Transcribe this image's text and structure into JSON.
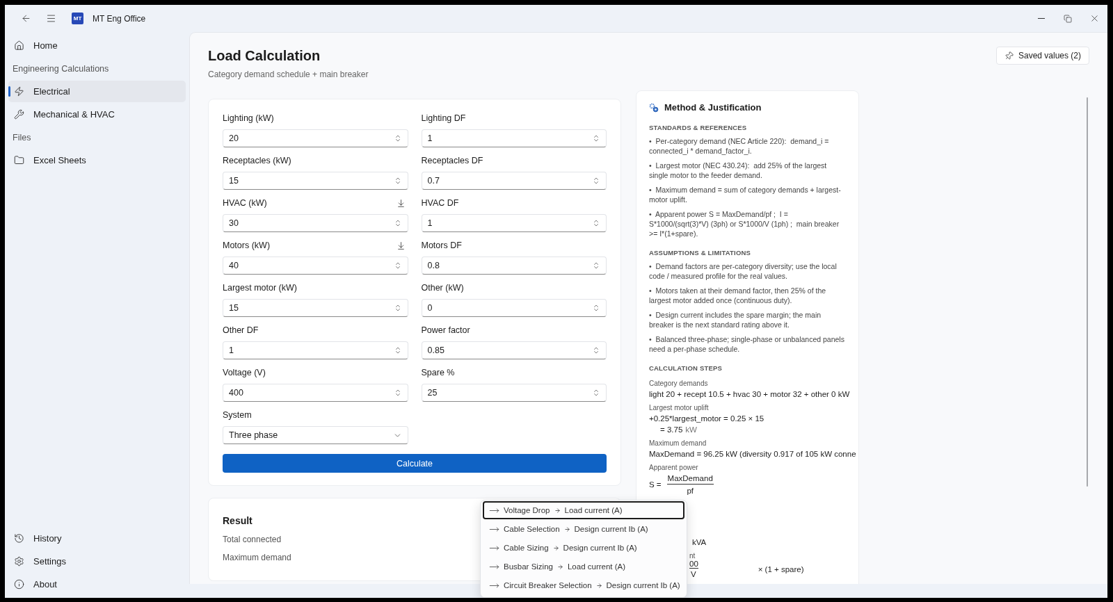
{
  "window": {
    "title": "MT Eng Office",
    "logo": "MT"
  },
  "sidebar": {
    "items": [
      {
        "kind": "item",
        "label": "Home",
        "selected": false
      },
      {
        "kind": "header",
        "label": "Engineering Calculations"
      },
      {
        "kind": "item",
        "label": "Electrical",
        "selected": true
      },
      {
        "kind": "item",
        "label": "Mechanical & HVAC",
        "selected": false
      },
      {
        "kind": "header",
        "label": "Files"
      },
      {
        "kind": "item",
        "label": "Excel Sheets",
        "selected": false
      }
    ],
    "footer": [
      {
        "label": "History"
      },
      {
        "label": "Settings"
      },
      {
        "label": "About"
      }
    ]
  },
  "page": {
    "title": "Load Calculation",
    "subtitle": "Category demand schedule + main breaker",
    "saved_button": "Saved values (2)"
  },
  "form": {
    "fields": [
      {
        "kind": "number",
        "label": "Lighting (kW)",
        "value": "20",
        "download": false
      },
      {
        "kind": "number",
        "label": "Lighting DF",
        "value": "1",
        "download": false
      },
      {
        "kind": "number",
        "label": "Receptacles (kW)",
        "value": "15",
        "download": false
      },
      {
        "kind": "number",
        "label": "Receptacles DF",
        "value": "0.7",
        "download": false
      },
      {
        "kind": "number",
        "label": "HVAC (kW)",
        "value": "30",
        "download": true
      },
      {
        "kind": "number",
        "label": "HVAC DF",
        "value": "1",
        "download": false
      },
      {
        "kind": "number",
        "label": "Motors (kW)",
        "value": "40",
        "download": true
      },
      {
        "kind": "number",
        "label": "Motors DF",
        "value": "0.8",
        "download": false
      },
      {
        "kind": "number",
        "label": "Largest motor (kW)",
        "value": "15",
        "download": false
      },
      {
        "kind": "number",
        "label": "Other (kW)",
        "value": "0",
        "download": false
      },
      {
        "kind": "number",
        "label": "Other DF",
        "value": "1",
        "download": false
      },
      {
        "kind": "number",
        "label": "Power factor",
        "value": "0.85",
        "download": false
      },
      {
        "kind": "number",
        "label": "Voltage (V)",
        "value": "400",
        "download": false
      },
      {
        "kind": "number",
        "label": "Spare %",
        "value": "25",
        "download": false
      },
      {
        "kind": "select",
        "label": "System",
        "value": "Three phase",
        "download": false
      }
    ],
    "button": "Calculate"
  },
  "result": {
    "title": "Result",
    "rows": [
      "Total connected",
      "Maximum demand"
    ]
  },
  "method": {
    "title": "Method & Justification",
    "sections": [
      {
        "heading": "STANDARDS & REFERENCES",
        "bullets": [
          "•  Per-category demand (NEC Article 220):  demand_i = connected_i * demand_factor_i.",
          "•  Largest motor (NEC 430.24):  add 25% of the largest single motor to the feeder demand.",
          "•  Maximum demand = sum of category demands + largest-motor uplift.",
          "•  Apparent power S = MaxDemand/pf ;  I = S*1000/(sqrt(3)*V) (3ph) or S*1000/V (1ph) ;  main breaker >= I*(1+spare)."
        ]
      },
      {
        "heading": "ASSUMPTIONS & LIMITATIONS",
        "bullets": [
          "•  Demand factors are per-category diversity; use the local code / measured profile for the real values.",
          "•  Motors taken at their demand factor, then 25% of the largest motor added once (continuous duty).",
          "•  Design current includes the spare margin; the main breaker is the next standard rating above it.",
          "•  Balanced three-phase; single-phase or unbalanced panels need a per-phase schedule."
        ]
      }
    ],
    "steps_heading": "CALCULATION STEPS",
    "steps": [
      {
        "kind": "line",
        "label": "Category demands",
        "lines": [
          "light 20 + recept 10.5 + hvac 30 + motor 32 + other 0 kW"
        ]
      },
      {
        "kind": "line",
        "label": "Largest motor uplift",
        "lines": [
          "+0.25*largest_motor = 0.25 × 15"
        ],
        "result": "= 3.75",
        "unit": "kW"
      },
      {
        "kind": "line",
        "label": "Maximum demand",
        "lines": [
          "MaxDemand = 96.25 kW (diversity 0.917 of 105 kW conne"
        ]
      },
      {
        "kind": "fraction",
        "label": "Apparent power",
        "lhs": "S =",
        "numerator": "MaxDemand",
        "denominator": "pf"
      }
    ],
    "covered": {
      "unit": "kVA",
      "label_tail": "nt",
      "numerator_tail": "00",
      "denominator": "V",
      "tail": "× (1 + spare)"
    }
  },
  "popup": {
    "items": [
      {
        "from": "Voltage Drop",
        "to": "Load current (A)",
        "focused": true
      },
      {
        "from": "Cable Selection",
        "to": "Design current Ib (A)",
        "focused": false
      },
      {
        "from": "Cable Sizing",
        "to": "Design current Ib (A)",
        "focused": false
      },
      {
        "from": "Busbar Sizing",
        "to": "Load current (A)",
        "focused": false
      },
      {
        "from": "Circuit Breaker Selection",
        "to": "Design current Ib (A)",
        "focused": false
      }
    ]
  }
}
